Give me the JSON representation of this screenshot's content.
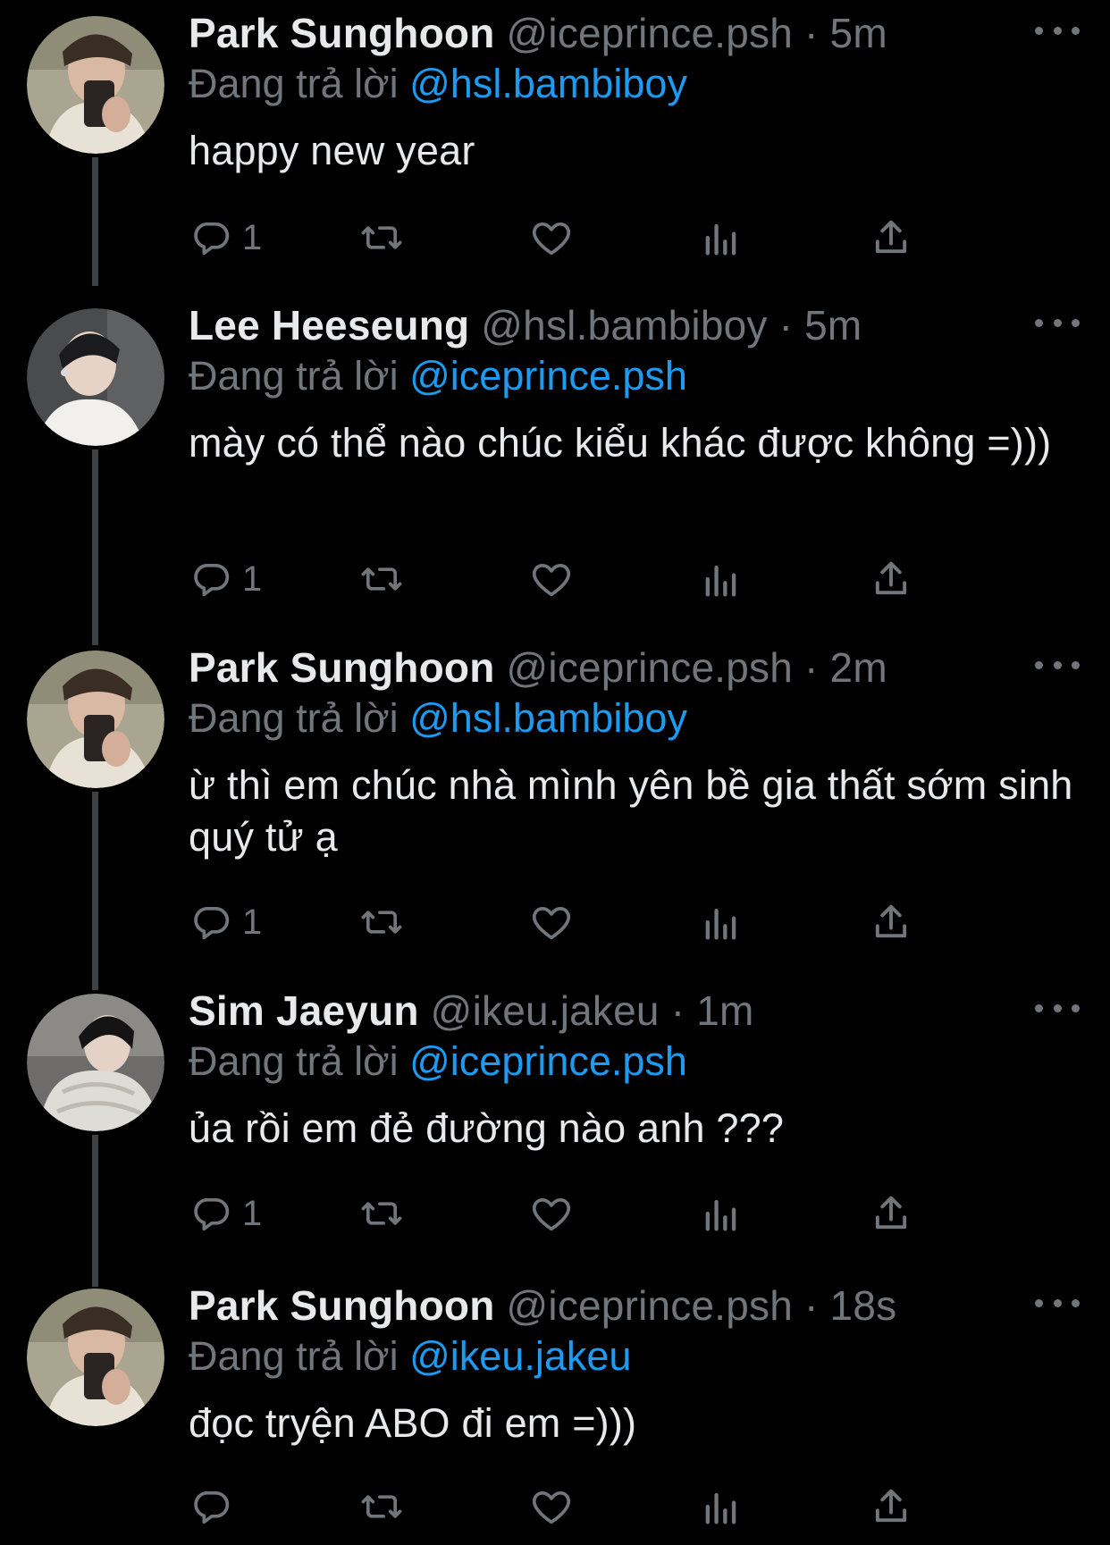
{
  "colors": {
    "background": "#000000",
    "text": "#e7e9ea",
    "muted": "#71767b",
    "accent": "#1d9bf0",
    "thread_line": "#3e4144"
  },
  "tweets": [
    {
      "name": "Park Sunghoon",
      "handle": "@iceprince.psh",
      "dot": "·",
      "time": "5m",
      "reply_prefix": "Đang trả lời",
      "reply_to": "@hsl.bambiboy",
      "text": "happy new year",
      "reply_count": "1",
      "avatar": "avatar-sunghoon"
    },
    {
      "name": "Lee Heeseung",
      "handle": "@hsl.bambiboy",
      "dot": "·",
      "time": "5m",
      "reply_prefix": "Đang trả lời",
      "reply_to": "@iceprince.psh",
      "text": "mày có thể nào chúc kiểu khác được không =)))",
      "reply_count": "1",
      "avatar": "avatar-heeseung"
    },
    {
      "name": "Park Sunghoon",
      "handle": "@iceprince.psh",
      "dot": "·",
      "time": "2m",
      "reply_prefix": "Đang trả lời",
      "reply_to": "@hsl.bambiboy",
      "text": "ừ thì em chúc nhà mình yên bề gia thất sớm sinh quý tử ạ",
      "reply_count": "1",
      "avatar": "avatar-sunghoon"
    },
    {
      "name": "Sim Jaeyun",
      "handle": "@ikeu.jakeu",
      "dot": "·",
      "time": "1m",
      "reply_prefix": "Đang trả lời",
      "reply_to": "@iceprince.psh",
      "text": "ủa rồi em đẻ đường nào anh ???",
      "reply_count": "1",
      "avatar": "avatar-jaeyun"
    },
    {
      "name": "Park Sunghoon",
      "handle": "@iceprince.psh",
      "dot": "·",
      "time": "18s",
      "reply_prefix": "Đang trả lời",
      "reply_to": "@ikeu.jakeu",
      "text": "đọc tryện ABO đi em =)))",
      "reply_count": "",
      "avatar": "avatar-sunghoon"
    }
  ],
  "icons": {
    "reply": "reply-icon",
    "retweet": "retweet-icon",
    "like": "heart-icon",
    "views": "views-icon",
    "share": "share-icon",
    "more": "more-icon"
  }
}
